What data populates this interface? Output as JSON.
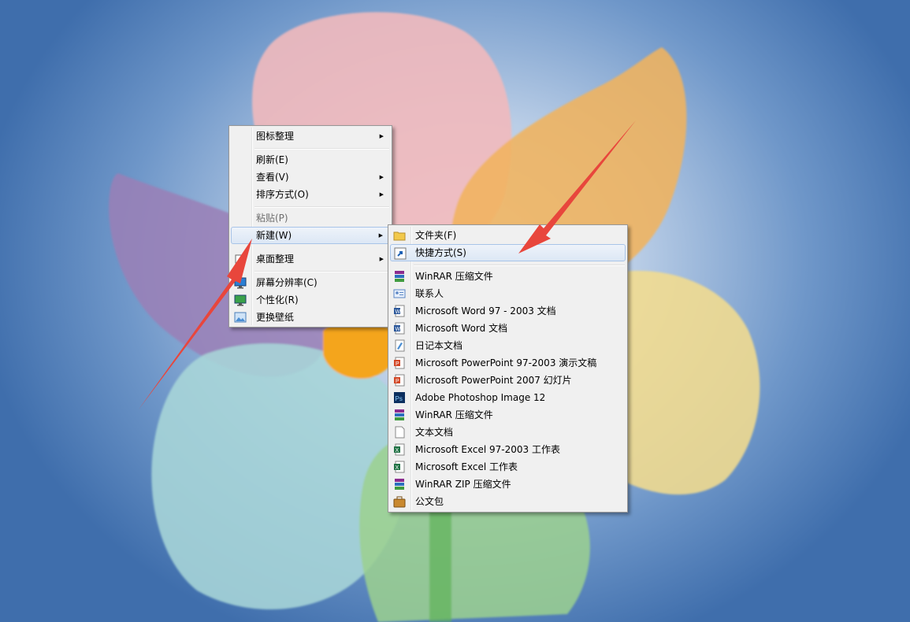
{
  "main_menu": {
    "items": [
      {
        "label": "图标整理",
        "submenu": true
      },
      {
        "label": "刷新(E)"
      },
      {
        "label": "查看(V)",
        "submenu": true
      },
      {
        "label": "排序方式(O)",
        "submenu": true
      },
      {
        "label": "粘贴(P)",
        "disabled": true
      },
      {
        "label": "新建(W)",
        "submenu": true,
        "highlighted": true
      },
      {
        "label": "桌面整理",
        "submenu": true
      },
      {
        "label": "屏幕分辨率(C)",
        "icon": "display-icon"
      },
      {
        "label": "个性化(R)",
        "icon": "personalize-icon"
      },
      {
        "label": "更换壁纸",
        "icon": "wallpaper-icon"
      }
    ]
  },
  "new_submenu": {
    "items": [
      {
        "label": "文件夹(F)",
        "icon": "folder-icon"
      },
      {
        "label": "快捷方式(S)",
        "icon": "shortcut-icon",
        "highlighted": true
      },
      {
        "label": "WinRAR 压缩文件",
        "icon": "winrar-icon"
      },
      {
        "label": "联系人",
        "icon": "contact-icon"
      },
      {
        "label": "Microsoft Word 97 - 2003 文档",
        "icon": "word-doc-icon"
      },
      {
        "label": "Microsoft Word 文档",
        "icon": "word-doc-icon"
      },
      {
        "label": "日记本文档",
        "icon": "journal-icon"
      },
      {
        "label": "Microsoft PowerPoint 97-2003 演示文稿",
        "icon": "powerpoint-icon"
      },
      {
        "label": "Microsoft PowerPoint 2007 幻灯片",
        "icon": "powerpoint-icon"
      },
      {
        "label": "Adobe Photoshop Image 12",
        "icon": "photoshop-icon"
      },
      {
        "label": "WinRAR 压缩文件",
        "icon": "winrar-icon"
      },
      {
        "label": "文本文档",
        "icon": "text-doc-icon"
      },
      {
        "label": "Microsoft Excel 97-2003 工作表",
        "icon": "excel-icon"
      },
      {
        "label": "Microsoft Excel 工作表",
        "icon": "excel-icon"
      },
      {
        "label": "WinRAR ZIP 压缩文件",
        "icon": "winrar-zip-icon"
      },
      {
        "label": "公文包",
        "icon": "briefcase-icon"
      }
    ]
  },
  "colors": {
    "annotation_arrow": "#e8463c",
    "menu_bg": "#f0f0f0",
    "highlight_border": "#a8c4e8"
  }
}
